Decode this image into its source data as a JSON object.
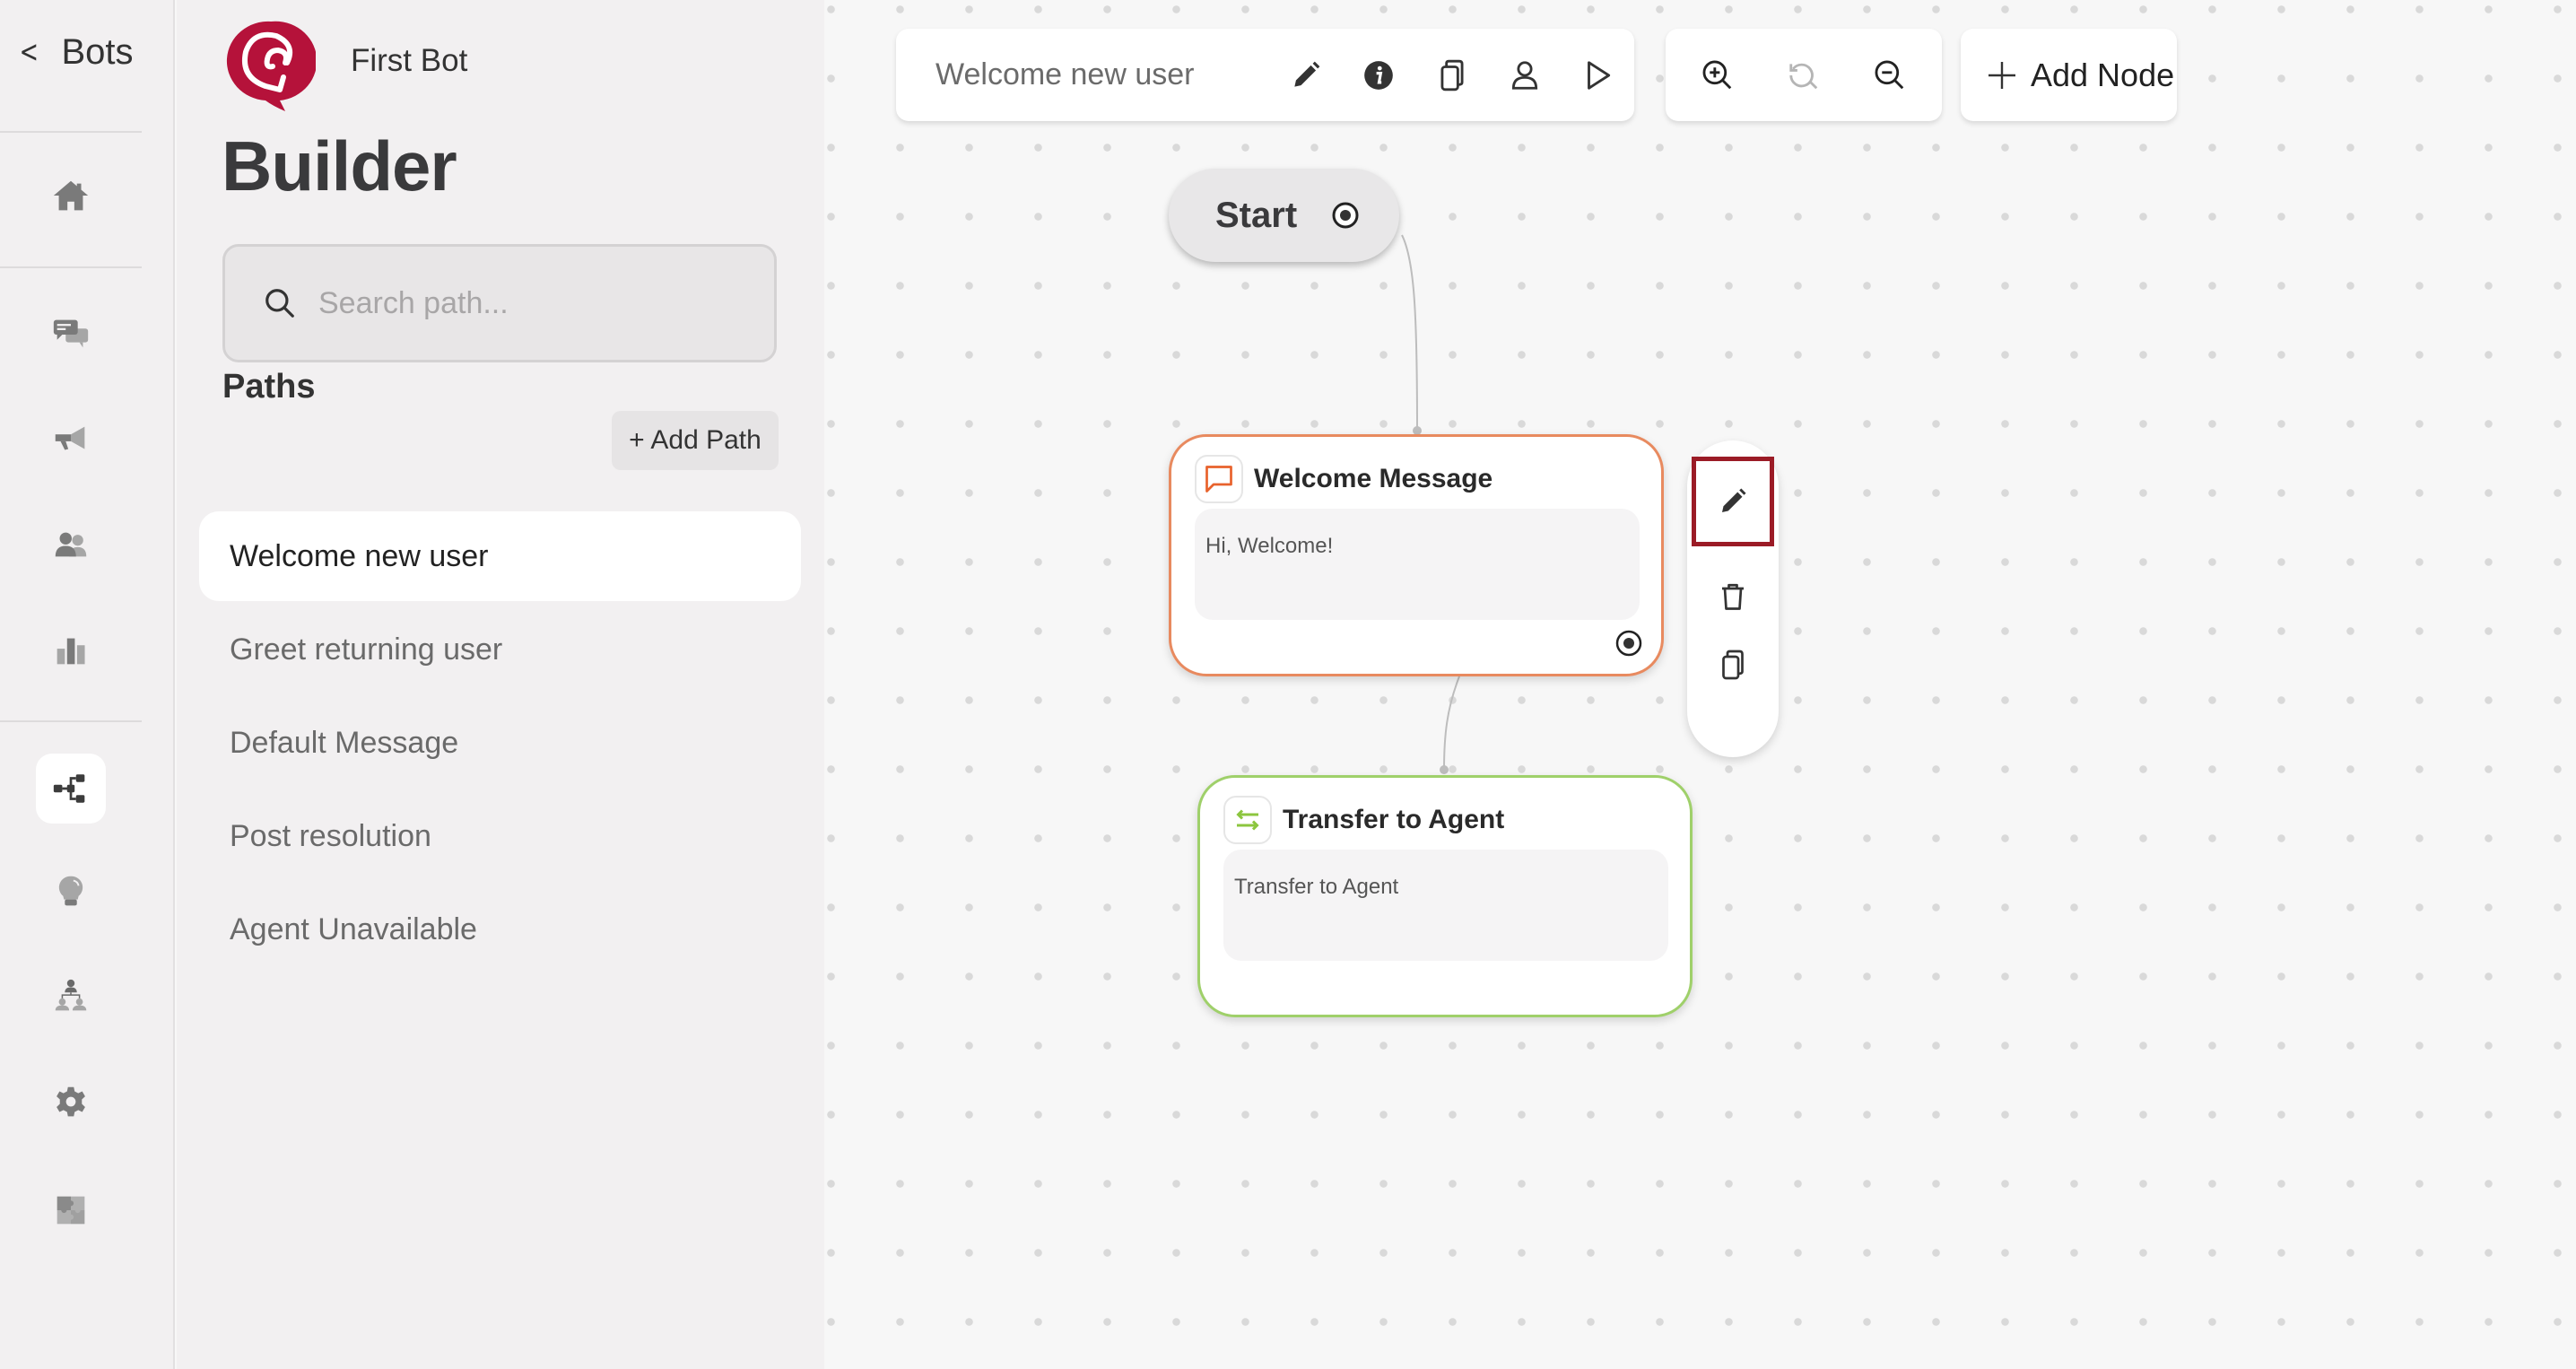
{
  "sidebar": {
    "back_label": "Bots",
    "items": [
      {
        "name": "home",
        "icon": "home-icon"
      },
      {
        "name": "conversations",
        "icon": "chat-bubbles-icon"
      },
      {
        "name": "campaigns",
        "icon": "megaphone-icon"
      },
      {
        "name": "contacts",
        "icon": "users-icon"
      },
      {
        "name": "analytics",
        "icon": "bar-chart-icon"
      },
      {
        "name": "builder",
        "icon": "flow-diagram-icon",
        "active": true
      },
      {
        "name": "knowledge",
        "icon": "lightbulb-icon"
      },
      {
        "name": "agents",
        "icon": "org-chart-icon"
      },
      {
        "name": "settings",
        "icon": "gear-icon"
      },
      {
        "name": "integrations",
        "icon": "puzzle-icon"
      }
    ]
  },
  "panel": {
    "bot_name": "First Bot",
    "title": "Builder",
    "search_placeholder": "Search path...",
    "search_value": "",
    "paths_heading": "Paths",
    "add_path_label": "+ Add Path",
    "paths": [
      {
        "label": "Welcome new user",
        "selected": true
      },
      {
        "label": "Greet returning user"
      },
      {
        "label": "Default Message"
      },
      {
        "label": "Post resolution"
      },
      {
        "label": "Agent Unavailable"
      }
    ]
  },
  "toolbar": {
    "path_name": "Welcome new user",
    "path_actions": [
      "edit-icon",
      "info-icon",
      "copy-icon",
      "user-icon",
      "play-icon"
    ],
    "zoom_actions": [
      "zoom-in-icon",
      "reset-zoom-icon",
      "zoom-out-icon"
    ],
    "add_node_label": "Add Node"
  },
  "flow": {
    "start_label": "Start",
    "nodes": [
      {
        "id": "welcome",
        "type": "message",
        "title": "Welcome Message",
        "body": "Hi, Welcome!",
        "accent": "#e8622c"
      },
      {
        "id": "transfer",
        "type": "transfer",
        "title": "Transfer to Agent",
        "body": "Transfer to Agent",
        "accent": "#8cc63f"
      }
    ],
    "node_actions": [
      "edit",
      "delete",
      "duplicate"
    ],
    "highlighted_action": "edit"
  },
  "colors": {
    "brand": "#b5123a",
    "highlight": "#9b1b26"
  }
}
